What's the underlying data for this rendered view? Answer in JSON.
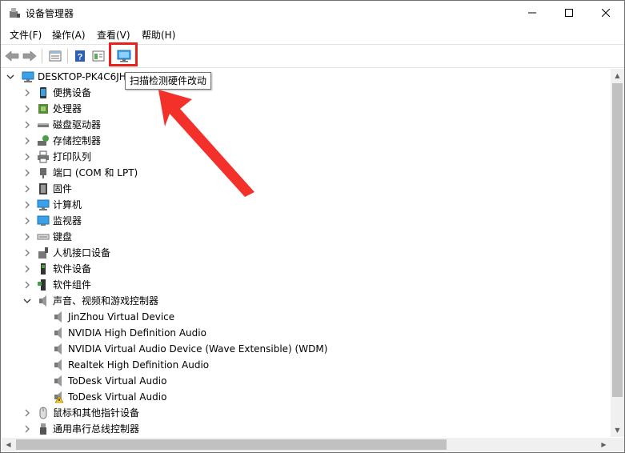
{
  "window": {
    "title": "设备管理器"
  },
  "menu": {
    "file": "文件(F)",
    "action": "操作(A)",
    "view": "查看(V)",
    "help": "帮助(H)"
  },
  "tooltip": "扫描检测硬件改动",
  "tree": {
    "root": "DESKTOP-PK4C6JH",
    "categories": [
      {
        "label": "便携设备"
      },
      {
        "label": "处理器"
      },
      {
        "label": "磁盘驱动器"
      },
      {
        "label": "存储控制器"
      },
      {
        "label": "打印队列"
      },
      {
        "label": "端口 (COM 和 LPT)"
      },
      {
        "label": "固件"
      },
      {
        "label": "计算机"
      },
      {
        "label": "监视器"
      },
      {
        "label": "键盘"
      },
      {
        "label": "人机接口设备"
      },
      {
        "label": "软件设备"
      },
      {
        "label": "软件组件"
      },
      {
        "label": "声音、视频和游戏控制器"
      },
      {
        "label": "鼠标和其他指针设备"
      },
      {
        "label": "通用串行总线控制器"
      }
    ],
    "audio_devices": [
      {
        "label": "JinZhou Virtual Device"
      },
      {
        "label": "NVIDIA High Definition Audio"
      },
      {
        "label": "NVIDIA Virtual Audio Device (Wave Extensible) (WDM)"
      },
      {
        "label": "Realtek High Definition Audio"
      },
      {
        "label": "ToDesk Virtual Audio"
      },
      {
        "label": "ToDesk Virtual Audio"
      }
    ]
  },
  "colors": {
    "highlight": "#e8221b",
    "arrow": "#f4302a",
    "icon_blue": "#1e88d0"
  }
}
